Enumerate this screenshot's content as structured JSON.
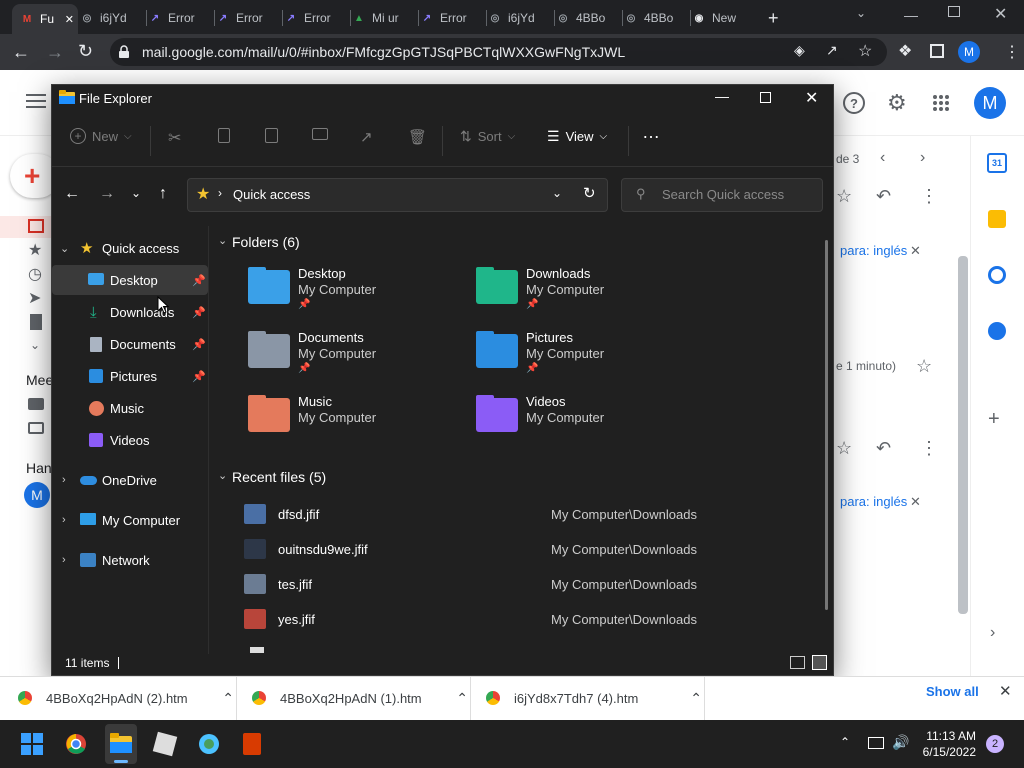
{
  "browser": {
    "tabs": [
      {
        "title": "Fu",
        "icon": "gmail-icon",
        "active": true
      },
      {
        "title": "i6jYd",
        "icon": "globe-icon"
      },
      {
        "title": "Error",
        "icon": "doc-icon"
      },
      {
        "title": "Error",
        "icon": "doc-icon"
      },
      {
        "title": "Error",
        "icon": "doc-icon"
      },
      {
        "title": "Mi ur",
        "icon": "drive-icon"
      },
      {
        "title": "Error",
        "icon": "doc-icon"
      },
      {
        "title": "i6jYd",
        "icon": "globe-icon"
      },
      {
        "title": "4BBo",
        "icon": "globe-icon"
      },
      {
        "title": "4BBo",
        "icon": "globe-icon"
      },
      {
        "title": "New",
        "icon": "chrome-icon"
      }
    ],
    "url": "mail.google.com/mail/u/0/#inbox/FMfcgzGpGTJSqPBCTqlWXXGwFNgTxJWL",
    "profile_initial": "M"
  },
  "gmail": {
    "avatar_initial": "M",
    "page_of": "de 3",
    "translate_label_1": "para: inglés",
    "time_text": "e 1 minuto)",
    "translate_label_2": "para: inglés",
    "meet_label": "Mee",
    "hang_label": "Han",
    "hang_avatar": "M",
    "calendar_day": "31"
  },
  "explorer": {
    "title": "File Explorer",
    "toolbar": {
      "new": "New",
      "sort": "Sort",
      "view": "View",
      "more": "…"
    },
    "address": "Quick access",
    "search_placeholder": "Search Quick access",
    "nav": {
      "quick_access": "Quick access",
      "desktop": "Desktop",
      "downloads": "Downloads",
      "documents": "Documents",
      "pictures": "Pictures",
      "music": "Music",
      "videos": "Videos",
      "onedrive": "OneDrive",
      "my_computer": "My Computer",
      "network": "Network"
    },
    "folders_header": "Folders (6)",
    "folders": [
      {
        "name": "Desktop",
        "location": "My Computer",
        "pinned": true,
        "color": "#3aa0e8"
      },
      {
        "name": "Downloads",
        "location": "My Computer",
        "pinned": true,
        "color": "#1fb68a"
      },
      {
        "name": "Documents",
        "location": "My Computer",
        "pinned": true,
        "color": "#8a96a6"
      },
      {
        "name": "Pictures",
        "location": "My Computer",
        "pinned": true,
        "color": "#2b8de0"
      },
      {
        "name": "Music",
        "location": "My Computer",
        "pinned": false,
        "color": "#e47a5c"
      },
      {
        "name": "Videos",
        "location": "My Computer",
        "pinned": false,
        "color": "#8b5cf6"
      }
    ],
    "recent_header": "Recent files (5)",
    "recent": [
      {
        "name": "dfsd.jfif",
        "location": "My Computer\\Downloads"
      },
      {
        "name": "ouitnsdu9we.jfif",
        "location": "My Computer\\Downloads"
      },
      {
        "name": "tes.jfif",
        "location": "My Computer\\Downloads"
      },
      {
        "name": "yes.jfif",
        "location": "My Computer\\Downloads"
      }
    ],
    "status": "11 items"
  },
  "downloads_bar": {
    "items": [
      "4BBoXq2HpAdN (2).htm",
      "4BBoXq2HpAdN (1).htm",
      "i6jYd8x7Tdh7 (4).htm"
    ],
    "show_all": "Show all"
  },
  "taskbar": {
    "time": "11:13 AM",
    "date": "6/15/2022",
    "notification_count": "2"
  }
}
